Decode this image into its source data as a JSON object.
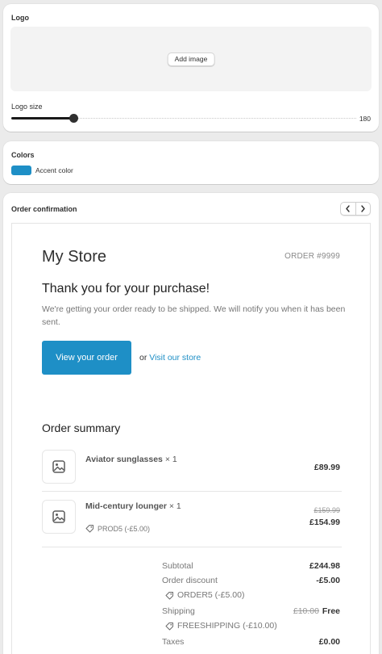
{
  "logo_card": {
    "title": "Logo",
    "add_image_label": "Add image",
    "logo_size_label": "Logo size",
    "logo_size_value": "180",
    "logo_size_fraction": 0.18
  },
  "colors_card": {
    "title": "Colors",
    "accent_label": "Accent color",
    "accent_hex": "#1e8fc6"
  },
  "order_card": {
    "title": "Order confirmation",
    "prev_icon": "chevron-left-icon",
    "next_icon": "chevron-right-icon"
  },
  "email": {
    "store_name": "My Store",
    "order_number": "ORDER #9999",
    "heading": "Thank you for your purchase!",
    "intro": "We're getting your order ready to be shipped. We will notify you when it has been sent.",
    "view_order_label": "View your order",
    "or_text": "or",
    "visit_store_label": "Visit our store",
    "summary_title": "Order summary",
    "items": [
      {
        "name": "Aviator sunglasses",
        "qty": "× 1",
        "price": "£89.99"
      },
      {
        "name": "Mid-century lounger",
        "qty": "× 1",
        "old_price": "£159.99",
        "price": "£154.99",
        "discount": "PROD5 (-£5.00)"
      }
    ],
    "totals": {
      "subtotal_label": "Subtotal",
      "subtotal_value": "£244.98",
      "discount_label": "Order discount",
      "discount_value": "-£5.00",
      "discount_code": "ORDER5 (-£5.00)",
      "shipping_label": "Shipping",
      "shipping_old": "£10.00",
      "shipping_value": "Free",
      "shipping_code": "FREESHIPPING (-£10.00)",
      "taxes_label": "Taxes",
      "taxes_value": "£0.00"
    }
  }
}
